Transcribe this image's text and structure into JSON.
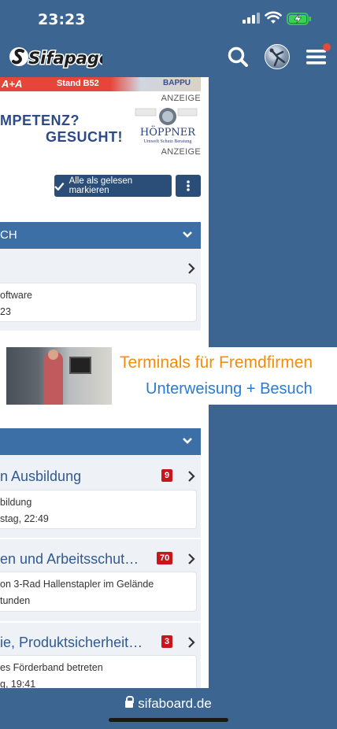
{
  "status_bar": {
    "time": "23:23"
  },
  "header": {
    "logo_text": "Sifapage"
  },
  "ads": {
    "top_banner": {
      "text_a": "A+A",
      "text_stand": "Stand B52",
      "brand": "BAPPU"
    },
    "label_1": "ANZEIGE",
    "hoeppner": {
      "line_1": "MPETENZ?",
      "line_2": "GESUCHT!",
      "brand": "HÖPPNER",
      "tagline": "Umwelt Schutz Beratung"
    },
    "label_2": "ANZEIGE",
    "terminals": {
      "line_1": "Terminals für Fremdfirmen",
      "line_2": "Unterweisung + Besuch"
    }
  },
  "actions": {
    "mark_all_read": "Alle als gelesen markieren"
  },
  "section_1": {
    "title": "CH",
    "last_post": {
      "line_1": "oftware",
      "line_2": "23"
    }
  },
  "section_2": {
    "forums": [
      {
        "title": "n Ausbildung",
        "badge": "9",
        "line_1": "bildung",
        "line_2": "stag, 22:49"
      },
      {
        "title": "en und Arbeitsschut…",
        "badge": "70",
        "line_1": "on 3-Rad Hallenstapler im Gelände",
        "line_2": "tunden"
      },
      {
        "title": "ie, Produktsicherheit…",
        "badge": "3",
        "line_1": "es Förderband betreten",
        "line_2": "g, 19:41"
      }
    ]
  },
  "bottom_bar": {
    "url": "sifaboard.de"
  }
}
